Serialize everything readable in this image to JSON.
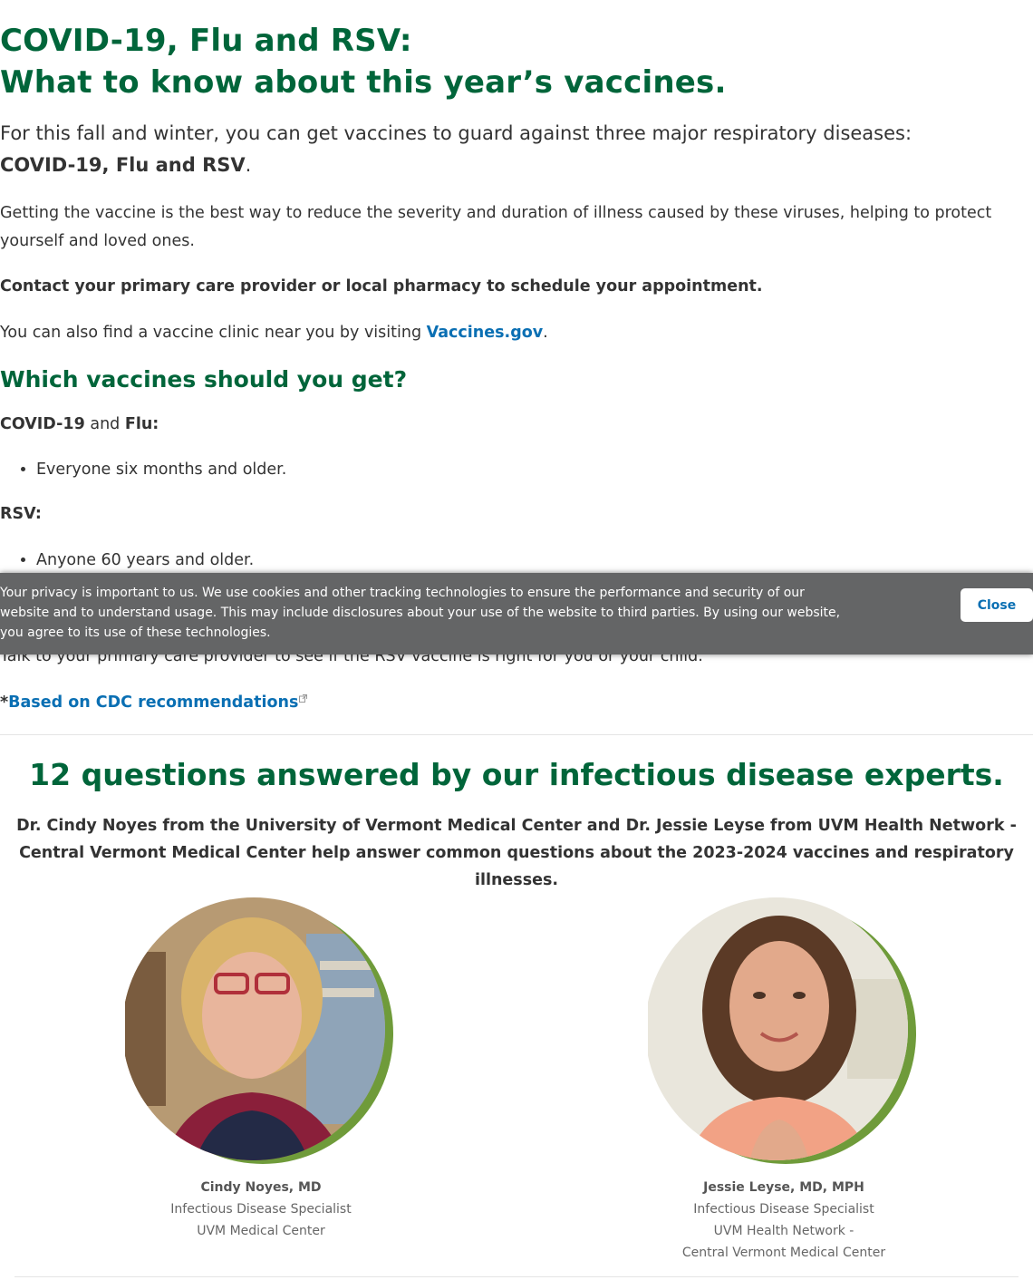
{
  "header": {
    "title_line1": "COVID-19, Flu and RSV:",
    "title_line2": "What to know about this year’s vaccines."
  },
  "intro": {
    "text": "For this fall and winter, you can get vaccines to guard against three major respiratory diseases:",
    "bold": "COVID-19, Flu and RSV",
    "end": "."
  },
  "body": {
    "p1": "Getting the vaccine is the best way to reduce the severity and duration of illness caused by these viruses, helping to protect yourself and loved ones.",
    "p2": "Contact your primary care provider or local pharmacy to schedule your appointment.",
    "p3_text": "You can also find a vaccine clinic near you by visiting",
    "p3_link": "Vaccines.gov",
    "p3_end": "."
  },
  "which": {
    "heading": "Which vaccines should you get?",
    "covid_label": "COVID-19",
    "and_text": "and",
    "flu_label": "Flu:",
    "covid_flu_items": [
      "Everyone six months and older."
    ],
    "rsv_label": "RSV:",
    "rsv_items": [
      "Anyone 60 years and older."
    ],
    "talk_text": "Talk to your primary care provider to see if the RSV vaccine is right for you or your child.",
    "cdc_prefix": "*",
    "cdc_link": "Based on CDC recommendations"
  },
  "cookie_banner": {
    "text": "Your privacy is important to us. We use cookies and other tracking technologies to ensure the performance and security of our website and to understand usage. This may include disclosures about your use of the website to third parties. By using our website, you agree to its use of these technologies.",
    "close_label": "Close"
  },
  "experts": {
    "title": "12 questions answered by our infectious disease experts.",
    "description": "Dr. Cindy Noyes from the University of Vermont Medical Center and Dr. Jessie Leyse from UVM Health Network - Central Vermont Medical Center help answer common questions about the 2023-2024 vaccines and respiratory illnesses.",
    "people": [
      {
        "name": "Cindy Noyes, MD",
        "role": "Infectious Disease Specialist",
        "org_line1": "UVM Medical Center",
        "org_line2": ""
      },
      {
        "name": "Jessie Leyse, MD, MPH",
        "role": "Infectious Disease Specialist",
        "org_line1": "UVM Health Network -",
        "org_line2": "Central Vermont Medical Center"
      }
    ]
  },
  "colors": {
    "heading_green": "#00653a",
    "link_blue": "#0a6fb3",
    "ring_green": "#6f9b3a",
    "banner_gray": "#646566"
  }
}
